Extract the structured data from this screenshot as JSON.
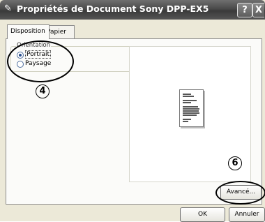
{
  "window": {
    "title": "Propriétés de Document Sony DPP-EX5"
  },
  "titlebar": {
    "help_label": "?",
    "close_label": "X"
  },
  "tabs": [
    {
      "label": "Disposition",
      "active": true
    },
    {
      "label": "Papier",
      "active": false
    }
  ],
  "orientation": {
    "group_title": "Orientation",
    "options": [
      {
        "label": "Portrait",
        "selected": true
      },
      {
        "label": "Paysage",
        "selected": false
      }
    ]
  },
  "annotations": {
    "callout_4": "4",
    "callout_6": "6"
  },
  "buttons": {
    "advanced_label": "Avancé...",
    "ok_label": "OK",
    "cancel_label": "Annuler"
  },
  "colors": {
    "titlebar": "#4a4a4a",
    "dialog_bg": "#ece9d8",
    "panel_bg": "#fbfbf9"
  }
}
